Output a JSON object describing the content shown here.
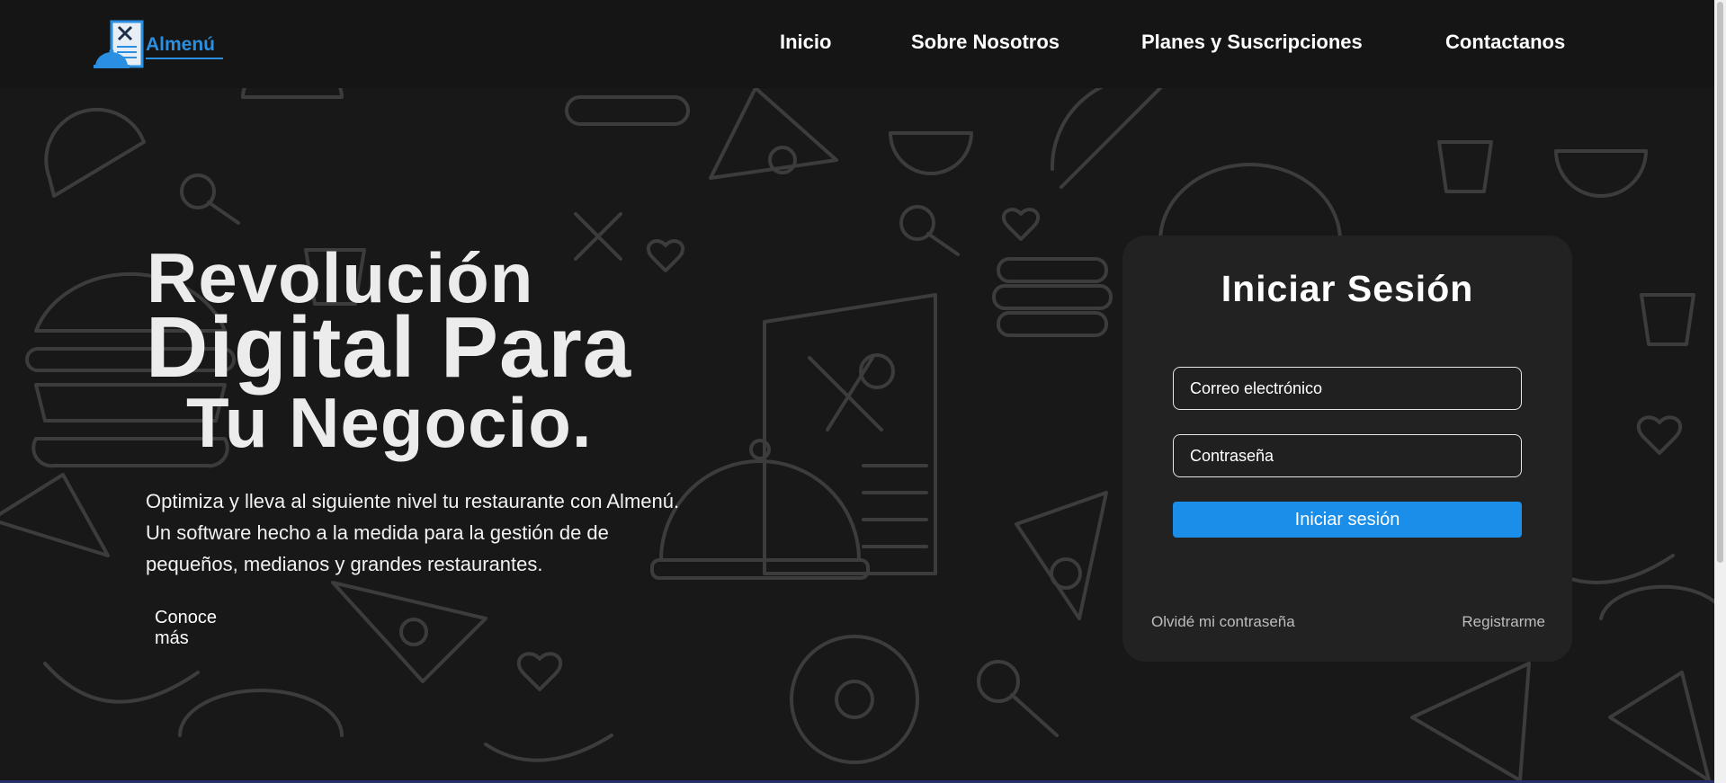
{
  "brand": {
    "name": "Almenú"
  },
  "nav": {
    "items": [
      {
        "label": "Inicio"
      },
      {
        "label": "Sobre Nosotros"
      },
      {
        "label": "Planes y Suscripciones"
      },
      {
        "label": "Contactanos"
      }
    ]
  },
  "hero": {
    "line1": "Revolución",
    "line2": "Digital Para",
    "line3": "Tu Negocio.",
    "description": [
      "Optimiza y lleva al siguiente nivel tu restaurante con Almenú.",
      "Un software hecho a la medida para la gestión de de",
      "pequeños, medianos y grandes restaurantes."
    ],
    "more_link": "Conoce más"
  },
  "login": {
    "title": "Iniciar Sesión",
    "email_placeholder": "Correo electrónico",
    "password_placeholder": "Contraseña",
    "submit_label": "Iniciar sesión",
    "forgot_label": "Olvidé mi contraseña",
    "register_label": "Registrarme"
  },
  "colors": {
    "accent": "#1a8ee8",
    "background": "#181818",
    "card": "#222222",
    "navbar": "#151515"
  },
  "icons": [
    "food-pattern-background",
    "logo-icon"
  ]
}
